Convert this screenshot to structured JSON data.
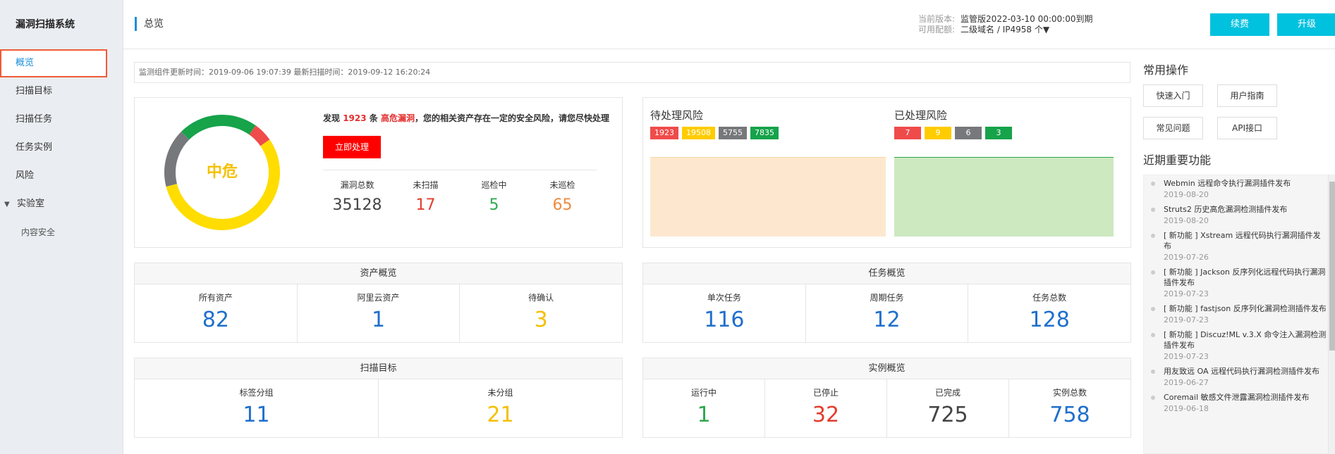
{
  "sidebar": {
    "brand": "漏洞扫描系统",
    "items": [
      {
        "label": "概览"
      },
      {
        "label": "扫描目标"
      },
      {
        "label": "扫描任务"
      },
      {
        "label": "任务实例"
      },
      {
        "label": "风险"
      },
      {
        "label": "实验室"
      },
      {
        "label": "内容安全"
      }
    ]
  },
  "header": {
    "page_title": "总览",
    "version_label": "当前版本:",
    "version_value": "监管版2022-03-10 00:00:00到期",
    "quota_label": "可用配额:",
    "quota_value": "二级域名 / IP4958 个▼",
    "renew_button": "续费",
    "upgrade_button": "升级"
  },
  "timebar": "监测组件更新时间：2019-09-06 19:07:39   最新扫描时间：2019-09-12 16:20:24",
  "risk_summary": {
    "level": "中危",
    "alert_prefix": "发现",
    "alert_count": "1923",
    "alert_mid": "条",
    "alert_high": "高危漏洞",
    "alert_suffix": "，您的相关资产存在一定的安全风险，请您尽快处理",
    "handle_button": "立即处理",
    "stats": [
      {
        "label": "漏洞总数",
        "value": "35128",
        "color": "#444444"
      },
      {
        "label": "未扫描",
        "value": "17",
        "color": "#e33d2d"
      },
      {
        "label": "巡检中",
        "value": "5",
        "color": "#2fa84f"
      },
      {
        "label": "未巡检",
        "value": "65",
        "color": "#f08a3c"
      }
    ],
    "donut": {
      "segments": [
        {
          "name": "high",
          "value": 1923,
          "color": "#f04b4b"
        },
        {
          "name": "mid",
          "value": 19508,
          "color": "#ffdd00"
        },
        {
          "name": "low",
          "value": 5755,
          "color": "#77787b"
        },
        {
          "name": "info",
          "value": 7835,
          "color": "#16a34a"
        }
      ]
    }
  },
  "pending": {
    "title": "待处理风险",
    "chips": [
      {
        "value": "1923",
        "color": "#f04b4b"
      },
      {
        "value": "19508",
        "color": "#ffcc00"
      },
      {
        "value": "5755",
        "color": "#77787b"
      },
      {
        "value": "7835",
        "color": "#16a34a"
      }
    ],
    "area_color": "#fde8cf",
    "area_border": "#f5d9a6"
  },
  "processed": {
    "title": "已处理风险",
    "chips": [
      {
        "value": "7",
        "color": "#f04b4b"
      },
      {
        "value": "9",
        "color": "#ffcc00"
      },
      {
        "value": "6",
        "color": "#77787b"
      },
      {
        "value": "3",
        "color": "#16a34a"
      }
    ],
    "area_color": "#cde9c0",
    "area_border": "#2ea84f"
  },
  "asset_overview": {
    "title": "资产概览",
    "cells": [
      {
        "label": "所有资产",
        "value": "82",
        "color": "#1f6fcc"
      },
      {
        "label": "阿里云资产",
        "value": "1",
        "color": "#1f6fcc"
      },
      {
        "label": "待确认",
        "value": "3",
        "color": "#f5c000"
      }
    ]
  },
  "task_overview": {
    "title": "任务概览",
    "cells": [
      {
        "label": "单次任务",
        "value": "116",
        "color": "#1f6fcc"
      },
      {
        "label": "周期任务",
        "value": "12",
        "color": "#1f6fcc"
      },
      {
        "label": "任务总数",
        "value": "128",
        "color": "#1f6fcc"
      }
    ]
  },
  "target_overview": {
    "title": "扫描目标",
    "cells": [
      {
        "label": "标签分组",
        "value": "11",
        "color": "#1f6fcc"
      },
      {
        "label": "未分组",
        "value": "21",
        "color": "#f5c000"
      }
    ]
  },
  "instance_overview": {
    "title": "实例概览",
    "cells": [
      {
        "label": "运行中",
        "value": "1",
        "color": "#2fa84f"
      },
      {
        "label": "已停止",
        "value": "32",
        "color": "#e33d2d"
      },
      {
        "label": "已完成",
        "value": "725",
        "color": "#444444"
      },
      {
        "label": "实例总数",
        "value": "758",
        "color": "#1f6fcc"
      }
    ]
  },
  "right_panel": {
    "ops_title": "常用操作",
    "ops": [
      "快速入门",
      "用户指南",
      "常见问题",
      "API接口"
    ],
    "features_title": "近期重要功能",
    "features": [
      {
        "title": "Webmin 远程命令执行漏洞插件发布",
        "date": "2019-08-20"
      },
      {
        "title": "Struts2 历史高危漏洞检测插件发布",
        "date": "2019-08-20"
      },
      {
        "title": "[ 新功能 ] Xstream 远程代码执行漏洞插件发布",
        "date": "2019-07-26"
      },
      {
        "title": "[ 新功能 ] Jackson 反序列化远程代码执行漏洞插件发布",
        "date": "2019-07-23"
      },
      {
        "title": "[ 新功能 ] fastjson 反序列化漏洞检测插件发布",
        "date": "2019-07-23"
      },
      {
        "title": "[ 新功能 ] Discuz!ML v.3.X 命令注入漏洞检测插件发布",
        "date": "2019-07-23"
      },
      {
        "title": "用友致远 OA 远程代码执行漏洞检测插件发布",
        "date": "2019-06-27"
      },
      {
        "title": "Coremail 敏感文件泄露漏洞检测插件发布",
        "date": "2019-06-18"
      }
    ]
  }
}
